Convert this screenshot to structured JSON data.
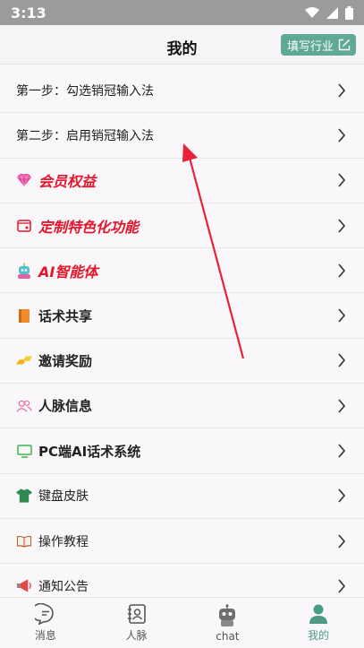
{
  "status": {
    "time": "3:13"
  },
  "header": {
    "title": "我的",
    "fill_label": "填写行业"
  },
  "rows": [
    {
      "label": "第一步：勾选销冠输入法",
      "icon": "none"
    },
    {
      "label": "第二步：启用销冠输入法",
      "icon": "none"
    },
    {
      "label": "会员权益",
      "icon": "diamond-icon"
    },
    {
      "label": "定制特色化功能",
      "icon": "wallet-icon"
    },
    {
      "label": "AI智能体",
      "icon": "robot-icon"
    },
    {
      "label": "话术共享",
      "icon": "book-icon"
    },
    {
      "label": "邀请奖励",
      "icon": "gold-bars-icon"
    },
    {
      "label": "人脉信息",
      "icon": "people-icon"
    },
    {
      "label": "PC端AI话术系统",
      "icon": "monitor-icon"
    },
    {
      "label": "键盘皮肤",
      "icon": "tshirt-icon"
    },
    {
      "label": "操作教程",
      "icon": "open-book-icon"
    },
    {
      "label": "通知公告",
      "icon": "megaphone-icon"
    }
  ],
  "tabs": [
    {
      "label": "消息",
      "icon": "chat-bubble-icon"
    },
    {
      "label": "人脉",
      "icon": "contacts-icon"
    },
    {
      "label": "chat",
      "icon": "robot-icon"
    },
    {
      "label": "我的",
      "icon": "person-icon"
    }
  ],
  "colors": {
    "accent": "#5fa996",
    "active_tab": "#4a9a86",
    "highlight_red": "#e3162c",
    "annotation_arrow": "#e8223a"
  }
}
